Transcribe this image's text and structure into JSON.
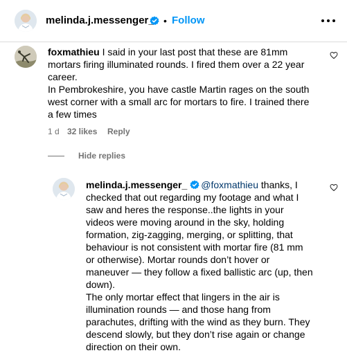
{
  "header": {
    "username": "melinda.j.messenger_",
    "separator": "•",
    "follow_label": "Follow",
    "more_icon": "more-horizontal-icon",
    "avatar_icon": "profile-avatar"
  },
  "comments": [
    {
      "username": "foxmathieu",
      "text": "I said in your last post that these are 81mm mortars firing illuminated rounds. I fired them over a 22 year career.\nIn Pembrokeshire, you have castle Martin rages on the south west corner with a small arc for mortars to fire. I trained there a few times",
      "time": "1 d",
      "likes": "32 likes",
      "reply_label": "Reply",
      "hide_replies_label": "Hide replies"
    }
  ],
  "reply": {
    "username": "melinda.j.messenger_",
    "mention": "@foxmathieu",
    "text": "thanks, I checked that out regarding my footage and what I saw and heres the response..the lights in your videos were moving around in the sky, holding formation, zig-zagging, merging, or splitting, that behaviour is not consistent with mortar fire (81 mm or otherwise). Mortar rounds don’t hover or maneuver — they follow a fixed ballistic arc (up, then down).\nThe only mortar effect that lingers in the air is illumination rounds — and those hang from parachutes, drifting with the wind as they burn. They descend slowly, but they don’t rise again or change direction on their own."
  },
  "colors": {
    "accent": "#0095f6",
    "verified": "#0095f6",
    "muted": "#737373",
    "mention": "#00376b",
    "divider": "#dbdbdb"
  }
}
